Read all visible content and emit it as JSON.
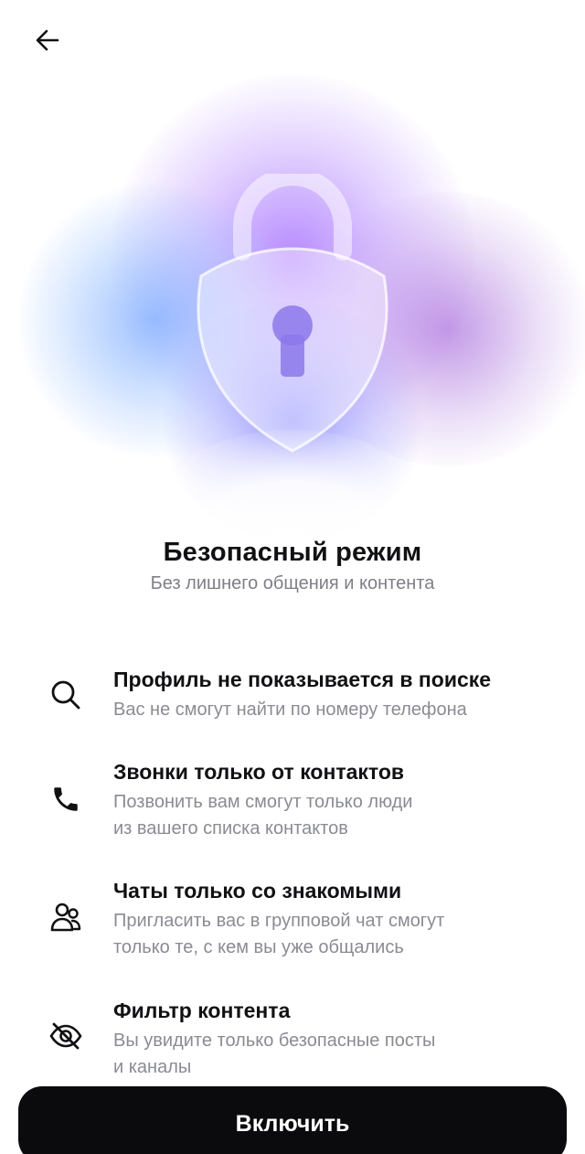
{
  "header": {
    "back_icon": "arrow-left-icon"
  },
  "hero": {
    "icon": "shield-lock-icon",
    "colors": {
      "purple": "#B07BFF",
      "blue": "#7FB0FF",
      "violet": "#A878D8",
      "indigo": "#7C7CFF"
    }
  },
  "page": {
    "title": "Безопасный режим",
    "subtitle": "Без лишнего общения и контента"
  },
  "features": [
    {
      "icon": "search-icon",
      "title": "Профиль не показывается в поиске",
      "description": "Вас не смогут найти по номеру телефона"
    },
    {
      "icon": "phone-icon",
      "title": "Звонки только от контактов",
      "description": "Позвонить вам смогут только люди\nиз вашего списка контактов"
    },
    {
      "icon": "people-icon",
      "title": "Чаты только со знакомыми",
      "description": "Пригласить вас в групповой чат смогут\nтолько те, с кем вы уже общались"
    },
    {
      "icon": "eye-off-icon",
      "title": "Фильтр контента",
      "description": "Вы увидите только безопасные посты\nи каналы"
    }
  ],
  "actions": {
    "enable_label": "Включить"
  }
}
